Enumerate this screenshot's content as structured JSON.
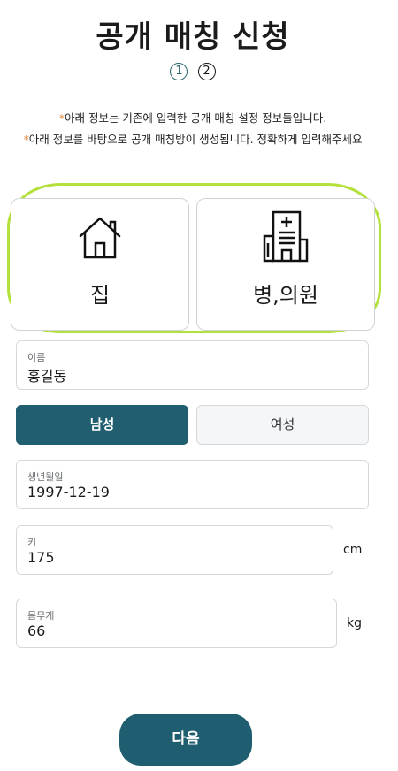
{
  "header": {
    "title": "공개 매칭 신청"
  },
  "steps": [
    "1",
    "2"
  ],
  "notes": [
    {
      "star": "*",
      "text": "아래 정보는 기존에 입력한 공개 매칭 설정 정보들입니다."
    },
    {
      "star": "*",
      "text": "아래 정보를 바탕으로 공개 매칭방이 생성됩니다. 정확하게 입력해주세요"
    }
  ],
  "location_options": [
    {
      "label": "집",
      "icon": "house-icon"
    },
    {
      "label": "병,의원",
      "icon": "hospital-icon"
    }
  ],
  "form": {
    "name": {
      "label": "이름",
      "value": "홍길동"
    },
    "gender": {
      "options": [
        "남성",
        "여성"
      ],
      "selected": "남성"
    },
    "birth": {
      "label": "생년월일",
      "value": "1997-12-19"
    },
    "height": {
      "label": "키",
      "value": "175",
      "unit": "cm"
    },
    "weight": {
      "label": "몸무게",
      "value": "66",
      "unit": "kg"
    }
  },
  "actions": {
    "next_label": "다음"
  },
  "colors": {
    "primary": "#205e70",
    "highlight": "#b3e03a",
    "accent": "#e8893b"
  }
}
